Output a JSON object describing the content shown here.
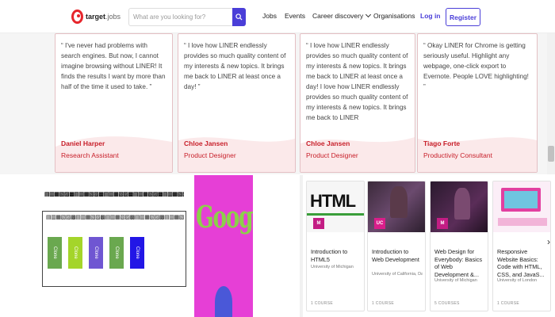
{
  "nav": {
    "logo_text": "target",
    "logo_sub": "jobs",
    "search_placeholder": "What are you looking for?",
    "links": [
      "Jobs",
      "Events",
      "Career discovery",
      "Organisations"
    ],
    "login": "Log in",
    "register": "Register",
    "accent": "#4a3ed8"
  },
  "testimonials": [
    {
      "quote": "“ I've never had problems with search engines. But now, I cannot imagine browsing without LINER! It finds the results I want by more than half of the time it used to take. ”",
      "name": "Daniel Harper",
      "role": "Research Assistant"
    },
    {
      "quote": "“ I love how LINER endlessly provides so much quality content of my interests & new topics. It brings me back to LINER at least once a day! ”",
      "name": "Chloe Jansen",
      "role": "Product Designer"
    },
    {
      "quote": "“ I love how LINER endlessly provides so much quality content of my interests & new topics. It brings me back to LINER at least once a day! I love how LINER endlessly provides so much quality content of my interests & new topics. It brings me back to LINER",
      "name": "Chloe Jansen",
      "role": "Product Designer"
    },
    {
      "quote": "“ Okay LINER for Chrome is getting seriously useful. Highlight any webpage, one-click export to Evernote. People LOVE highlighting! ”",
      "name": "Tiago Forte",
      "role": "Productivity Consultant"
    }
  ],
  "preview": {
    "google_text": "Google",
    "chips": [
      "Clone",
      "Clone",
      "Clone",
      "Clone",
      "Clone"
    ]
  },
  "courses": [
    {
      "title": "Introduction to HTML5",
      "uni": "University of Michigan",
      "footer": "1 COURSE",
      "thumb_text": "HTML"
    },
    {
      "title": "Introduction to Web Development",
      "uni": "University of California, Davis",
      "footer": "1 COURSE"
    },
    {
      "title": "Web Design for Everybody: Basics of Web Development &...",
      "uni": "University of Michigan",
      "footer": "5 COURSES"
    },
    {
      "title": "Responsive Website Basics: Code with HTML, CSS, and JavaS...",
      "uni": "University of London",
      "footer": "1 COURSE"
    }
  ]
}
